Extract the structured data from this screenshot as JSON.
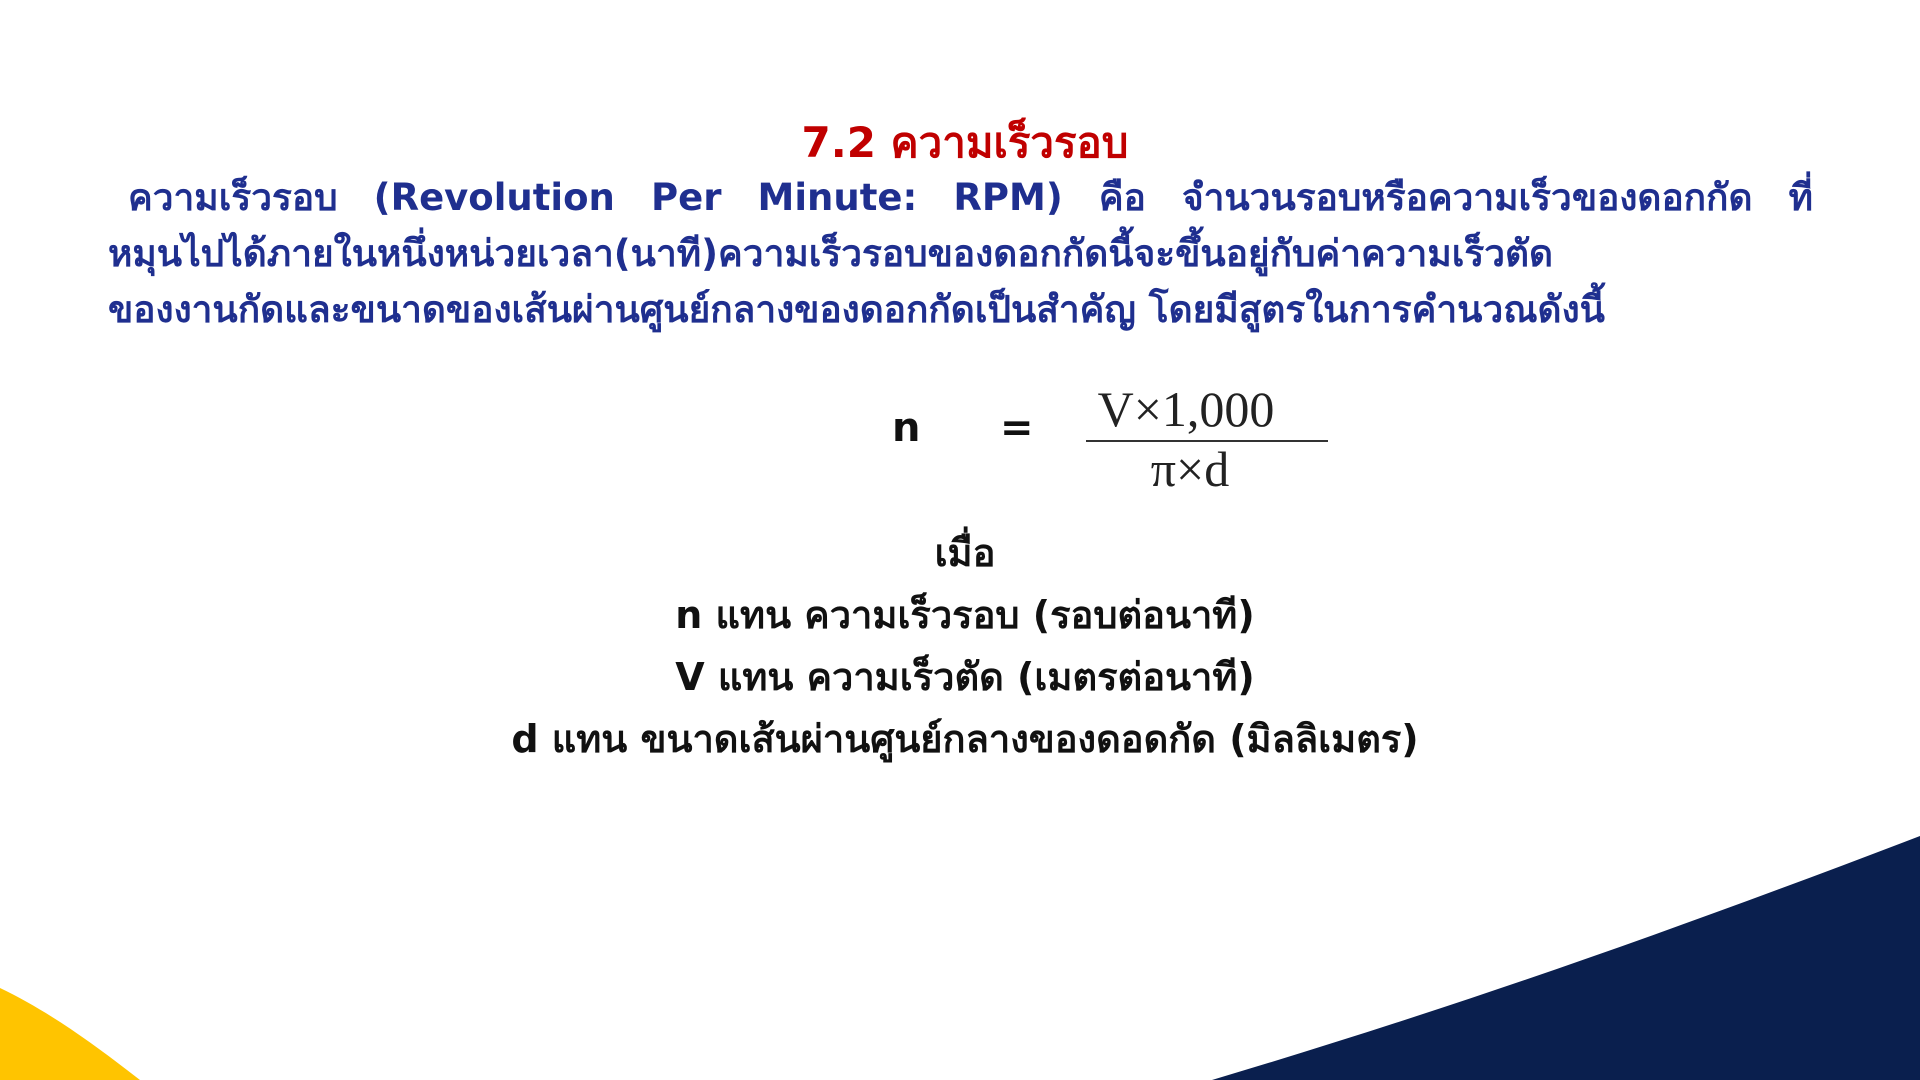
{
  "title": "7.2 ความเร็วรอบ",
  "paragraph": {
    "line1": "ความเร็วรอบ (Revolution Per Minute: RPM) คือ จำนวนรอบหรือความเร็วของดอกกัด ที่",
    "line2": "หมุนไปได้ภายในหนึ่งหน่วยเวลา(นาที)ความเร็วรอบของดอกกัดนี้จะขึ้นอยู่กับค่าความเร็วตัด",
    "line3": "ของงานกัดและขนาดของเส้นผ่านศูนย์กลางของดอกกัดเป็นสำคัญ โดยมีสูตรในการคำนวณดังนี้"
  },
  "formula": {
    "lhs": "n",
    "equals": "=",
    "numerator": "V×1,000",
    "denominator": "π×d"
  },
  "definitions": {
    "heading": "เมื่อ",
    "items": [
      "n แทน ความเร็วรอบ (รอบต่อนาที)",
      "V แทน ความเร็วตัด (เมตรต่อนาที)",
      "d แทน ขนาดเส้นผ่านศูนย์กลางของดอดกัด (มิลลิเมตร)"
    ]
  },
  "colors": {
    "title": "#c00000",
    "paragraph": "#1f2f8f",
    "navy_accent": "#0a1f4e",
    "yellow_accent": "#ffc400"
  }
}
